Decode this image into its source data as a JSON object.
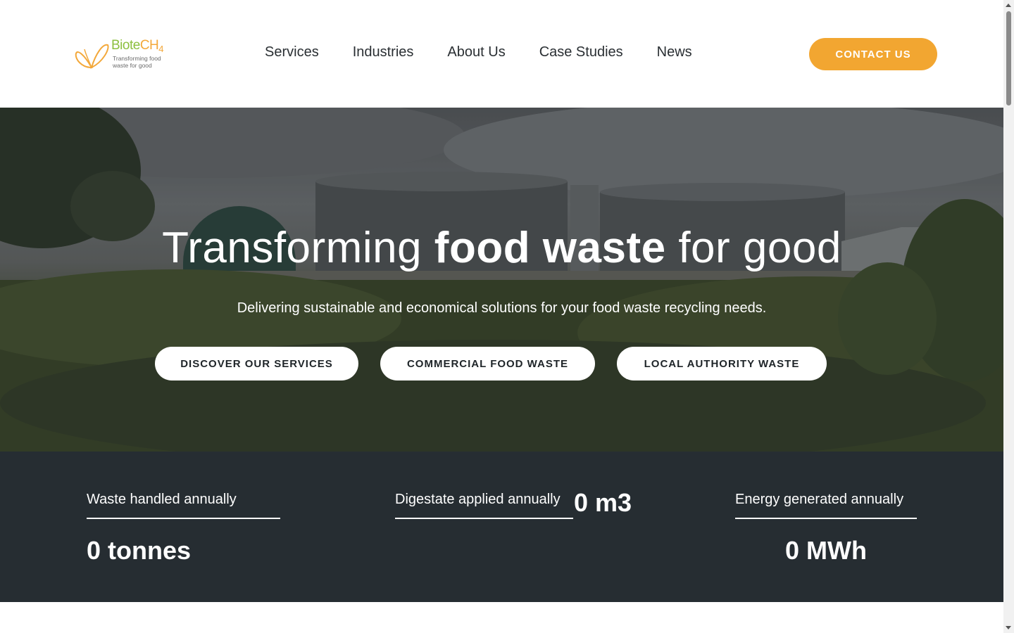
{
  "brand": {
    "name_part1": "Biote",
    "name_part2": "CH",
    "name_sub": "4",
    "tagline": "Transforming food waste for good",
    "logo_icon": "butterfly-icon",
    "colors": {
      "green": "#8cbf3f",
      "orange": "#f3a83a"
    }
  },
  "nav": {
    "items": [
      {
        "label": "Services"
      },
      {
        "label": "Industries"
      },
      {
        "label": "About Us"
      },
      {
        "label": "Case Studies"
      },
      {
        "label": "News"
      }
    ],
    "contact_label": "CONTACT US"
  },
  "hero": {
    "title_pre": "Transforming ",
    "title_bold": "food waste",
    "title_post": " for good",
    "subtitle": "Delivering sustainable and economical solutions for your food waste recycling needs.",
    "buttons": [
      {
        "label": "DISCOVER OUR SERVICES"
      },
      {
        "label": "COMMERCIAL FOOD WASTE"
      },
      {
        "label": "LOCAL AUTHORITY WASTE"
      }
    ]
  },
  "stats": [
    {
      "label": "Waste handled annually",
      "value": "0 tonnes"
    },
    {
      "label": "Digestate applied annually",
      "value": "0 m3"
    },
    {
      "label": "Energy generated annually",
      "value": "0 MWh"
    }
  ],
  "colors": {
    "accent": "#f2a631",
    "stats_bg": "#262d32",
    "nav_text": "#2a2f33"
  }
}
